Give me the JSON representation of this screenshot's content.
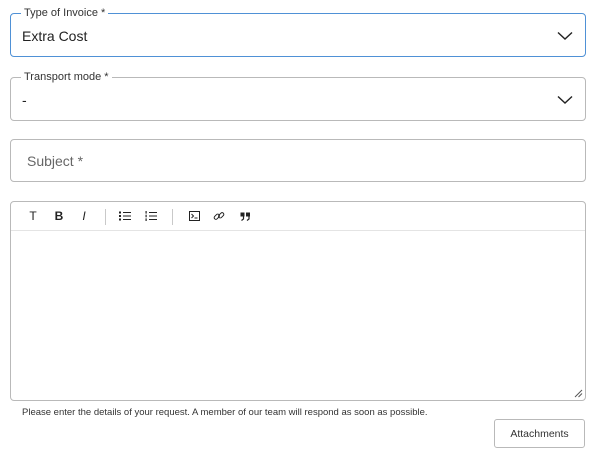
{
  "invoice_type": {
    "label": "Type of Invoice *",
    "value": "Extra Cost",
    "icon": "chevron-down-icon"
  },
  "transport_mode": {
    "label": "Transport mode *",
    "value": "-",
    "icon": "chevron-down-icon"
  },
  "subject": {
    "placeholder": "Subject *"
  },
  "editor": {
    "toolbar": {
      "text_size": "T",
      "bold": "B",
      "italic": "I",
      "icons": [
        "text-size-icon",
        "bold-icon",
        "italic-icon",
        "bulleted-list-icon",
        "numbered-list-icon",
        "code-block-icon",
        "link-icon",
        "quote-icon"
      ]
    },
    "content": ""
  },
  "help_text": "Please enter the details of your request. A member of our team will respond as soon as possible.",
  "attachments_button": "Attachments",
  "colors": {
    "focused_border": "#4f91d6",
    "border": "#b9b9b9",
    "text": "#222222"
  }
}
